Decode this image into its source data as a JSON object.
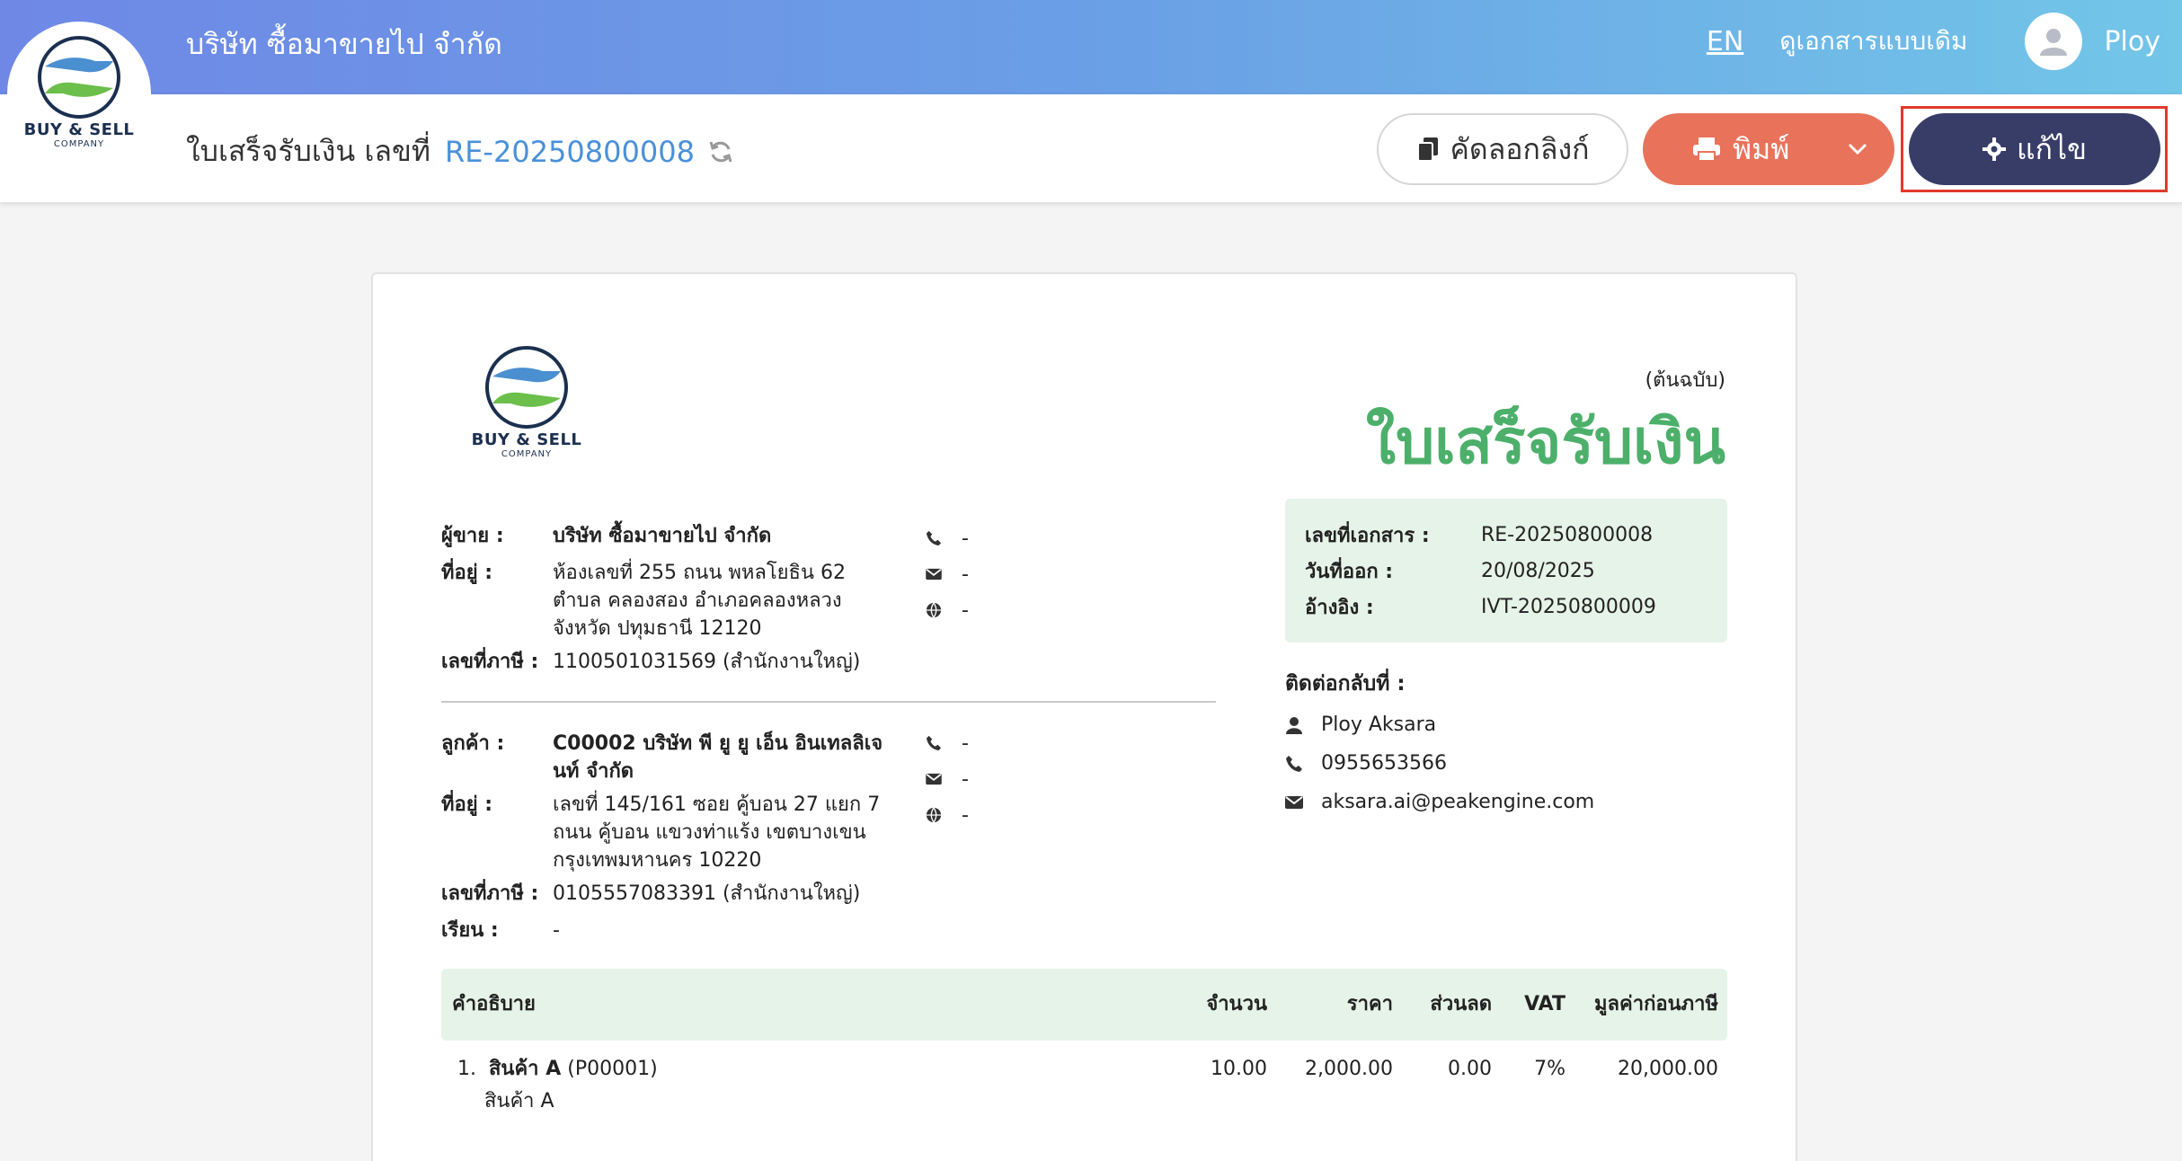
{
  "app": {
    "company_name": "บริษัท ซื้อมาขายไป จำกัด",
    "lang_toggle": "EN",
    "old_doc_link": "ดูเอกสารแบบเดิม",
    "user_name": "Ploy",
    "logo_text": "BUY & SELL",
    "logo_subtext": "COMPANY"
  },
  "header": {
    "doc_label": "ใบเสร็จรับเงิน เลขที่",
    "doc_number": "RE-20250800008",
    "copy_link": "คัดลอกลิงก์",
    "print": "พิมพ์",
    "edit": "แก้ไข"
  },
  "document": {
    "original_tag": "(ต้นฉบับ)",
    "title": "ใบเสร็จรับเงิน",
    "info": [
      {
        "k": "เลขที่เอกสาร :",
        "v": "RE-20250800008"
      },
      {
        "k": "วันที่ออก :",
        "v": "20/08/2025"
      },
      {
        "k": "อ้างอิง :",
        "v": "IVT-20250800009"
      }
    ],
    "contact_title": "ติดต่อกลับที่ :",
    "contact": {
      "name": "Ploy Aksara",
      "phone": "0955653566",
      "email": "aksara.ai@peakengine.com"
    },
    "seller": {
      "label": "ผู้ขาย :",
      "name": "บริษัท ซื้อมาขายไป จำกัด",
      "addr_label": "ที่อยู่ :",
      "address": "ห้องเลขที่ 255 ถนน พหลโยธิน 62 ตำบล คลองสอง อำเภอคลองหลวง จังหวัด ปทุมธานี 12120",
      "tax_label": "เลขที่ภาษี :",
      "tax_id": "1100501031569 (สำนักงานใหญ่)",
      "phone": "-",
      "email": "-",
      "web": "-"
    },
    "buyer": {
      "label": "ลูกค้า :",
      "name": "C00002 บริษัท พี ยู ยู เอ็น อินเทลลิเจนท์ จำกัด",
      "addr_label": "ที่อยู่ :",
      "address": "เลขที่ 145/161     ซอย คู้บอน 27 แยก 7 ถนน คู้บอน  แขวงท่าแร้ง เขตบางเขน กรุงเทพมหานคร 10220",
      "tax_label": "เลขที่ภาษี :",
      "tax_id": "0105557083391 (สำนักงานใหญ่)",
      "attn_label": "เรียน :",
      "attn": "-",
      "phone": "-",
      "email": "-",
      "web": "-"
    },
    "table": {
      "headers": {
        "desc": "คำอธิบาย",
        "qty": "จำนวน",
        "price": "ราคา",
        "discount": "ส่วนลด",
        "vat": "VAT",
        "amount": "มูลค่าก่อนภาษี"
      },
      "rows": [
        {
          "no": "1.",
          "name": "สินค้า A",
          "code": "(P00001)",
          "sub": "สินค้า A",
          "qty": "10.00",
          "price": "2,000.00",
          "discount": "0.00",
          "vat": "7%",
          "amount": "20,000.00"
        }
      ]
    }
  },
  "colors": {
    "accent_green": "#4caf6a",
    "print_orange": "#e8735a",
    "edit_navy": "#383d68",
    "link_blue": "#4a90d9"
  }
}
